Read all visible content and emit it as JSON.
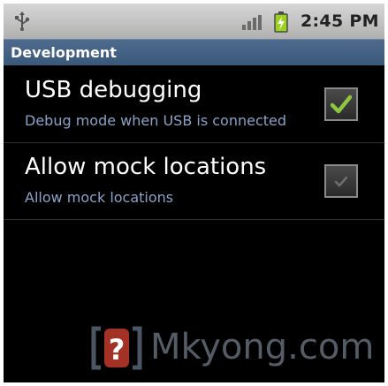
{
  "status_bar": {
    "time": "2:45 PM",
    "icons": [
      "usb-icon",
      "signal-icon",
      "battery-charging-icon"
    ],
    "battery_color": "#9bd21b"
  },
  "section": {
    "title": "Development"
  },
  "settings": [
    {
      "title": "USB debugging",
      "summary": "Debug mode when USB is connected",
      "checked": true
    },
    {
      "title": "Allow mock locations",
      "summary": "Allow mock locations",
      "checked": true
    }
  ],
  "watermark": {
    "text": "Mkyong.com",
    "logo_glyph": "?",
    "logo_color": "#c0392b"
  },
  "colors": {
    "summary_text": "#8aa3c6",
    "header_bg": "#3a5878",
    "check_active": "#8ec63f",
    "check_inactive": "#6e6e6e"
  }
}
